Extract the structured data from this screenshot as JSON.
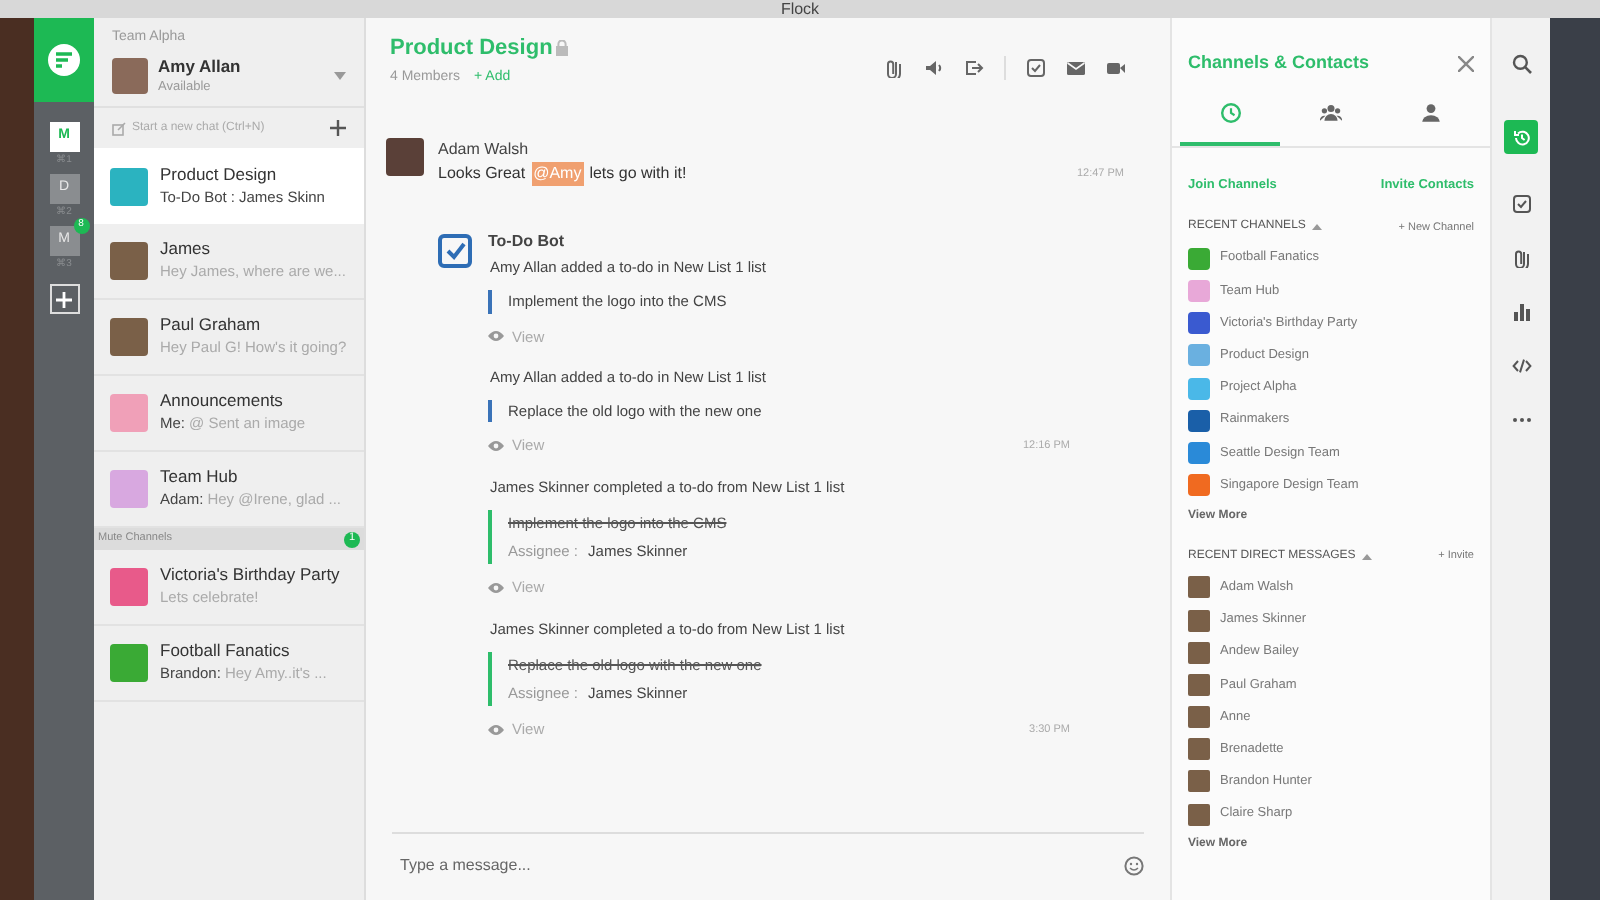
{
  "window": {
    "title": "Flock"
  },
  "workspaces": [
    {
      "label": "M",
      "shortcut": "⌘1",
      "selected": true
    },
    {
      "label": "D",
      "shortcut": "⌘2",
      "selected": false
    },
    {
      "label": "M",
      "shortcut": "⌘3",
      "selected": false,
      "badge": "8"
    }
  ],
  "chat_list": {
    "team": "Team Alpha",
    "user": {
      "name": "Amy Allan",
      "status": "Available"
    },
    "new_chat": "Start a new chat (Ctrl+N)",
    "items": [
      {
        "kind": "channel",
        "color": "#2bb3c0",
        "name": "Product Design",
        "sender": "To-Do Bot :",
        "preview": "James Skinn",
        "selected": true
      },
      {
        "kind": "person",
        "name": "James",
        "preview": "Hey James, where are we...",
        "selected": false
      },
      {
        "kind": "person",
        "name": "Paul Graham",
        "preview": "Hey Paul G! How's it going?",
        "selected": false
      },
      {
        "kind": "channel",
        "color": "#f0a0b8",
        "name": "Announcements",
        "sender": "Me:",
        "preview": "@ Sent an image",
        "selected": false
      },
      {
        "kind": "channel",
        "color": "#d8a8e0",
        "name": "Team Hub",
        "sender": "Adam:",
        "preview": "Hey @Irene, glad ...",
        "selected": false
      }
    ],
    "mute_section": {
      "label": "Mute Channels",
      "count": "1",
      "items": [
        {
          "kind": "channel",
          "color": "#e85a8a",
          "name": "Victoria's Birthday Party",
          "preview": "Lets celebrate!",
          "selected": false
        },
        {
          "kind": "channel",
          "color": "#3aaa35",
          "name": "Football  Fanatics",
          "sender": "Brandon:",
          "preview": "Hey Amy..it's ...",
          "selected": false
        }
      ]
    }
  },
  "chat": {
    "title": "Product Design",
    "members": "4 Members",
    "add": "+ Add",
    "toolbar": [
      {
        "kind": "attachment"
      },
      {
        "kind": "speaker"
      },
      {
        "kind": "leave"
      },
      {
        "kind": "todo"
      },
      {
        "kind": "mail"
      },
      {
        "kind": "video"
      }
    ],
    "messages": [
      {
        "kind": "user",
        "author": "Adam Walsh",
        "text": "Looks Great",
        "mention": "@Amy",
        "text_after": "lets go with it!",
        "time": "12:47 PM"
      },
      {
        "kind": "bot",
        "author": "To-Do Bot",
        "events": [
          {
            "text": "Amy Allan added a to-do in New List 1 list",
            "task": "Implement the logo into the CMS",
            "done": false,
            "view": "View"
          },
          {
            "text": "Amy Allan added a to-do in New List 1 list",
            "task": "Replace the old logo with the new one",
            "done": false,
            "view": "View",
            "time": "12:16 PM"
          },
          {
            "text": "James Skinner completed a to-do from New List 1 list",
            "task": "Implement the logo into the CMS",
            "done": true,
            "assignee_label": "Assignee :",
            "assignee": "James Skinner",
            "view": "View"
          },
          {
            "text": "James Skinner completed a to-do from New List 1 list",
            "task": "Replace the old logo with the new one",
            "done": true,
            "assignee_label": "Assignee :",
            "assignee": "James Skinner",
            "view": "View",
            "time": "3:30 PM"
          }
        ]
      }
    ],
    "composer": {
      "placeholder": "Type a message..."
    }
  },
  "panel": {
    "title": "Channels & Contacts",
    "tabs": [
      {
        "kind": "clock",
        "selected": true
      },
      {
        "kind": "group",
        "selected": false
      },
      {
        "kind": "person",
        "selected": false
      }
    ],
    "join": "Join Channels",
    "invite_contacts": "Invite Contacts",
    "channels": {
      "heading": "RECENT CHANNELS",
      "action": "+ New Channel",
      "view_more": "View More",
      "items": [
        {
          "name": "Football Fanatics",
          "color": "#3aaa35"
        },
        {
          "name": "Team Hub",
          "color": "#e8a8d8"
        },
        {
          "name": "Victoria's Birthday Party",
          "color": "#3a5ad0"
        },
        {
          "name": "Product Design",
          "color": "#6ab0e0"
        },
        {
          "name": "Project Alpha",
          "color": "#4ab8e8"
        },
        {
          "name": "Rainmakers",
          "color": "#1a5fa8"
        },
        {
          "name": "Seattle Design Team",
          "color": "#2a8ad8"
        },
        {
          "name": "Singapore Design Team",
          "color": "#f06a20"
        }
      ]
    },
    "dms": {
      "heading": "RECENT DIRECT MESSAGES",
      "action": "+ Invite",
      "view_more": "View More",
      "items": [
        {
          "name": "Adam Walsh"
        },
        {
          "name": "James Skinner"
        },
        {
          "name": "Andew Bailey"
        },
        {
          "name": "Paul Graham"
        },
        {
          "name": "Anne"
        },
        {
          "name": "Brenadette"
        },
        {
          "name": "Brandon Hunter"
        },
        {
          "name": "Claire Sharp"
        }
      ]
    }
  },
  "rail": [
    {
      "kind": "search",
      "selected": false
    },
    {
      "kind": "history",
      "selected": true
    },
    {
      "kind": "todo",
      "selected": false
    },
    {
      "kind": "attachment",
      "selected": false
    },
    {
      "kind": "chart",
      "selected": false
    },
    {
      "kind": "code",
      "selected": false
    },
    {
      "kind": "more",
      "selected": false
    }
  ]
}
